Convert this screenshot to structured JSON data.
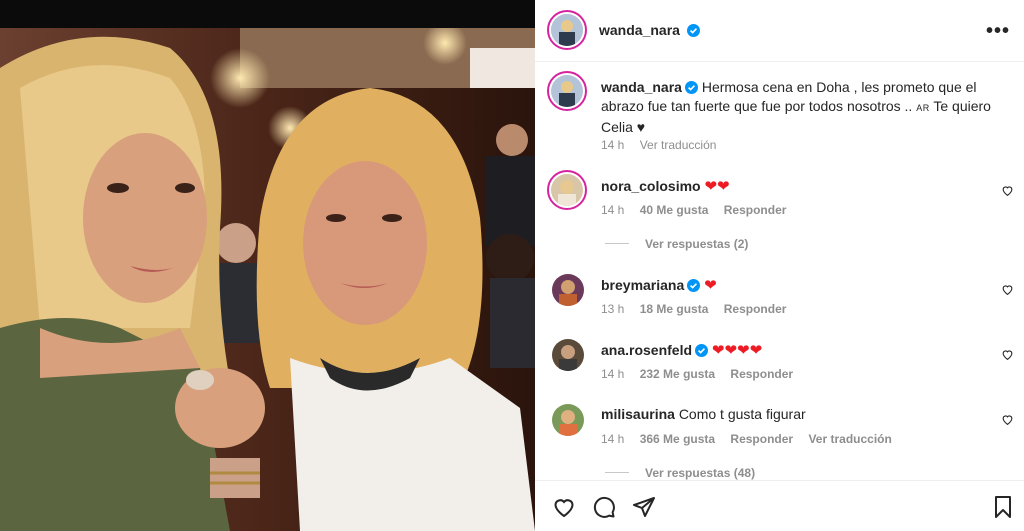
{
  "post": {
    "author": "wanda_nara",
    "more_label": "•••",
    "caption_text": "Hermosa cena en Doha , les prometo que el abrazo fue tan fuerte que fue por todos nosotros ..",
    "caption_flag": "AR",
    "caption_end": "Te quiero Celia ♥",
    "caption_time": "14 h",
    "caption_translate": "Ver traducción"
  },
  "comments": [
    {
      "user": "nora_colosimo",
      "text": "❤❤",
      "time": "14 h",
      "likes": "40 Me gusta",
      "reply": "Responder",
      "view_replies": "Ver respuestas (2)"
    },
    {
      "user": "breymariana",
      "text": "❤",
      "time": "13 h",
      "likes": "18 Me gusta",
      "reply": "Responder"
    },
    {
      "user": "ana.rosenfeld",
      "text": "❤❤❤❤",
      "time": "14 h",
      "likes": "232 Me gusta",
      "reply": "Responder"
    },
    {
      "user": "milisaurina",
      "text": "Como t gusta figurar",
      "time": "14 h",
      "likes": "366 Me gusta",
      "reply": "Responder",
      "translate": "Ver traducción",
      "view_replies": "Ver respuestas (48)"
    }
  ],
  "icons": [
    "verified-icon",
    "heart-icon",
    "comment-icon",
    "share-icon",
    "bookmark-icon",
    "more-icon"
  ],
  "colors": {
    "verified": "#0095f6",
    "heart_red": "#ed1c24",
    "muted": "#8e8e8e",
    "ring": "#d6249f"
  }
}
